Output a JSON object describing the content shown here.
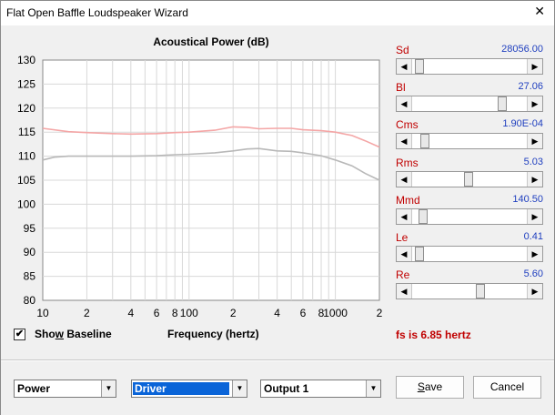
{
  "window": {
    "title": "Flat Open Baffle Loudspeaker Wizard",
    "close_glyph": "✕"
  },
  "chart_data": {
    "type": "line",
    "title": "Acoustical Power (dB)",
    "xlabel": "Frequency (hertz)",
    "ylabel": "",
    "x_scale": "log",
    "xlim": [
      10,
      2000
    ],
    "ylim": [
      80,
      130
    ],
    "x_ticks": [
      10,
      20,
      40,
      60,
      80,
      100,
      200,
      400,
      600,
      800,
      1000,
      2000
    ],
    "x_tick_labels": [
      "10",
      "2",
      "4",
      "6",
      "8",
      "100",
      "2",
      "4",
      "6",
      "8",
      "1000",
      "2"
    ],
    "y_ticks": [
      80,
      85,
      90,
      95,
      100,
      105,
      110,
      115,
      120,
      125,
      130
    ],
    "grid": true,
    "series": [
      {
        "color": "#f4a6a6",
        "x": [
          10,
          15,
          20,
          30,
          40,
          60,
          80,
          100,
          150,
          200,
          250,
          300,
          400,
          500,
          600,
          800,
          1000,
          1300,
          1600,
          2000
        ],
        "y": [
          115.8,
          115.1,
          114.9,
          114.7,
          114.6,
          114.7,
          114.9,
          115.0,
          115.4,
          116.1,
          116.0,
          115.7,
          115.8,
          115.8,
          115.5,
          115.3,
          115.0,
          114.3,
          113.2,
          111.9
        ]
      },
      {
        "color": "#b8b8b8",
        "x": [
          10,
          12,
          15,
          20,
          30,
          40,
          60,
          80,
          100,
          150,
          200,
          250,
          300,
          400,
          500,
          600,
          800,
          1000,
          1300,
          1600,
          2000
        ],
        "y": [
          109.2,
          109.8,
          110.0,
          110.0,
          110.0,
          110.0,
          110.1,
          110.3,
          110.4,
          110.7,
          111.1,
          111.5,
          111.6,
          111.1,
          111.0,
          110.7,
          110.1,
          109.2,
          108.0,
          106.4,
          105.0
        ]
      }
    ]
  },
  "params": [
    {
      "label": "Sd",
      "value": "28056.00",
      "level": 0.03
    },
    {
      "label": "Bl",
      "value": "27.06",
      "level": 0.81
    },
    {
      "label": "Cms",
      "value": "1.90E-04",
      "level": 0.08
    },
    {
      "label": "Rms",
      "value": "5.03",
      "level": 0.49
    },
    {
      "label": "Mmd",
      "value": "140.50",
      "level": 0.06
    },
    {
      "label": "Le",
      "value": "0.41",
      "level": 0.03
    },
    {
      "label": "Re",
      "value": "5.60",
      "level": 0.6
    }
  ],
  "show_baseline": {
    "checked": true,
    "label_pre": "Sho",
    "label_ul": "w",
    "label_post": " Baseline"
  },
  "fs_text": "fs is 6.85 hertz",
  "combos": {
    "plot_type": "Power",
    "source": "Driver",
    "output": "Output 1"
  },
  "buttons": {
    "save_ul": "S",
    "save_rest": "ave",
    "cancel": "Cancel"
  },
  "glyphs": {
    "check": "✔",
    "arrow_left": "◀",
    "arrow_right": "▶",
    "dropdown": "▼"
  }
}
